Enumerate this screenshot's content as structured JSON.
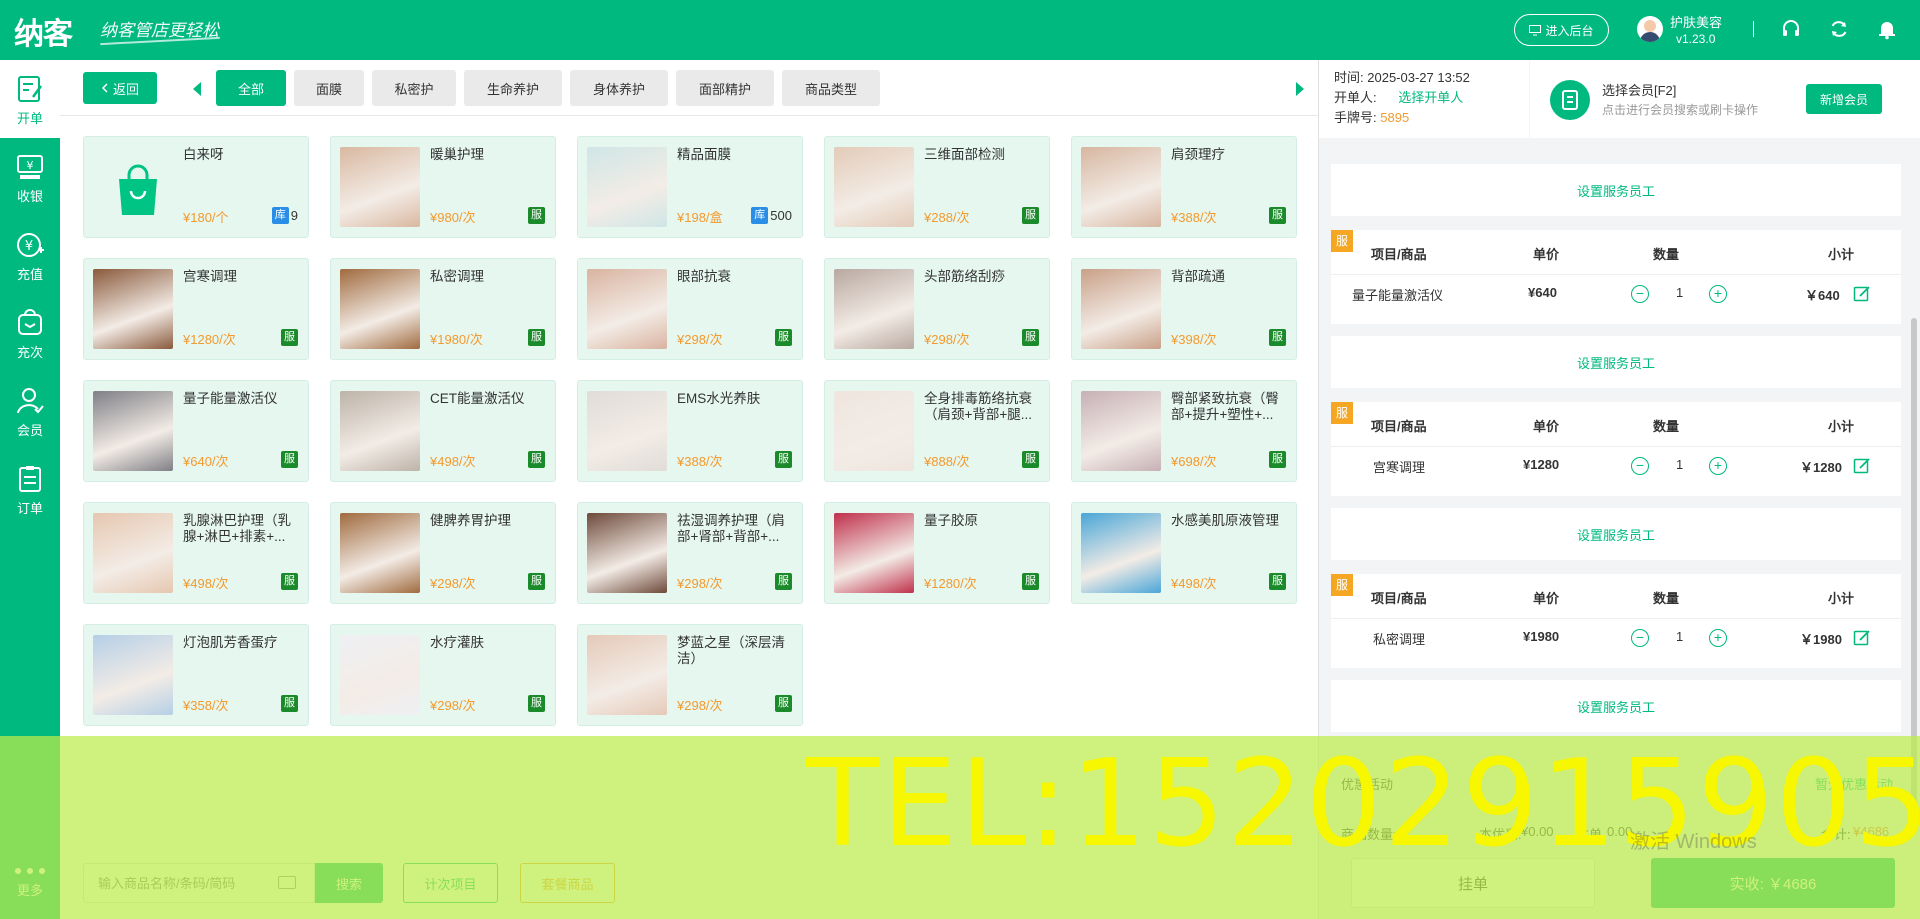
{
  "header": {
    "logo": "纳客",
    "slogan": "纳客管店更轻松",
    "backend_label": "进入后台",
    "store_name": "护肤美容",
    "version": "v1.23.0"
  },
  "sidebar": {
    "items": [
      {
        "label": "开单",
        "icon": "receipt-edit-icon"
      },
      {
        "label": "收银",
        "icon": "cashier-icon"
      },
      {
        "label": "充值",
        "icon": "yen-plus-icon"
      },
      {
        "label": "充次",
        "icon": "bag-recharge-icon"
      },
      {
        "label": "会员",
        "icon": "member-icon"
      },
      {
        "label": "订单",
        "icon": "order-list-icon"
      }
    ],
    "more_label": "更多"
  },
  "toolbar": {
    "back_label": "返回",
    "tabs": [
      "全部",
      "面膜",
      "私密护",
      "生命养护",
      "身体养护",
      "面部精护",
      "商品类型"
    ]
  },
  "products": [
    {
      "name": "白来呀",
      "price": "¥180/个",
      "stock_tag": "库",
      "stock": "9",
      "thumb": "bag-icon"
    },
    {
      "name": "暖巢护理",
      "price": "¥980/次",
      "tag": "服",
      "thumb": "#d9b8a0"
    },
    {
      "name": "精品面膜",
      "price": "¥198/盒",
      "stock_tag": "库",
      "stock": "500",
      "thumb": "#cfe6e6"
    },
    {
      "name": "三维面部检测",
      "price": "¥288/次",
      "tag": "服",
      "thumb": "#e3cbb8"
    },
    {
      "name": "肩颈理疗",
      "price": "¥388/次",
      "tag": "服",
      "thumb": "#d7b6a0"
    },
    {
      "name": "宫寒调理",
      "price": "¥1280/次",
      "tag": "服",
      "thumb": "#8a5a3c"
    },
    {
      "name": "私密调理",
      "price": "¥1980/次",
      "tag": "服",
      "thumb": "#a06b3f"
    },
    {
      "name": "眼部抗衰",
      "price": "¥298/次",
      "tag": "服",
      "thumb": "#d9b3a0"
    },
    {
      "name": "头部筋络刮痧",
      "price": "¥298/次",
      "tag": "服",
      "thumb": "#b8a8a0"
    },
    {
      "name": "背部疏通",
      "price": "¥398/次",
      "tag": "服",
      "thumb": "#c9a088"
    },
    {
      "name": "量子能量激活仪",
      "price": "¥640/次",
      "tag": "服",
      "thumb": "#7f7f86"
    },
    {
      "name": "CET能量激活仪",
      "price": "¥498/次",
      "tag": "服",
      "thumb": "#bcb3a8"
    },
    {
      "name": "EMS水光养肤",
      "price": "¥388/次",
      "tag": "服",
      "thumb": "#e0dcd8"
    },
    {
      "name": "全身排毒筋络抗衰（肩颈+背部+腿...",
      "price": "¥888/次",
      "tag": "服",
      "thumb": "#efe5df"
    },
    {
      "name": "臀部紧致抗衰（臀部+提升+塑性+...",
      "price": "¥698/次",
      "tag": "服",
      "thumb": "#c7b0b6"
    },
    {
      "name": "乳腺淋巴护理（乳腺+淋巴+排素+...",
      "price": "¥498/次",
      "tag": "服",
      "thumb": "#e6c7b0"
    },
    {
      "name": "健脾养胃护理",
      "price": "¥298/次",
      "tag": "服",
      "thumb": "#a06b3f"
    },
    {
      "name": "祛湿调养护理（肩部+肾部+背部+...",
      "price": "¥298/次",
      "tag": "服",
      "thumb": "#6e4a3a"
    },
    {
      "name": "量子胶原",
      "price": "¥1280/次",
      "tag": "服",
      "thumb": "#c0304c"
    },
    {
      "name": "水感美肌原液管理",
      "price": "¥498/次",
      "tag": "服",
      "thumb": "#4aa6d8"
    },
    {
      "name": "灯泡肌芳香蛋疗",
      "price": "¥358/次",
      "tag": "服",
      "thumb": "#b5cfe6"
    },
    {
      "name": "水疗灌肤",
      "price": "¥298/次",
      "tag": "服",
      "thumb": "#eef0f4"
    },
    {
      "name": "梦蓝之星（深层清洁）",
      "price": "¥298/次",
      "tag": "服",
      "thumb": "#e5c9b8"
    }
  ],
  "order_info": {
    "time_label": "时间:",
    "time_value": "2025-03-27 13:52",
    "opener_label": "开单人:",
    "opener_value": "选择开单人",
    "tag_label": "手牌号:",
    "tag_value": "5895"
  },
  "member": {
    "title": "选择会员[F2]",
    "subtitle": "点击进行会员搜索或刷卡操作",
    "new_member_label": "新增会员"
  },
  "order": {
    "set_staff_label": "设置服务员工",
    "svc_badge": "服",
    "headers": {
      "item": "项目/商品",
      "unit_price": "单价",
      "qty": "数量",
      "subtotal": "小计"
    },
    "lines": [
      {
        "name": "量子能量激活仪",
        "unit_price": "¥640",
        "qty": "1",
        "subtotal": "￥640"
      },
      {
        "name": "宫寒调理",
        "unit_price": "¥1280",
        "qty": "1",
        "subtotal": "￥1280"
      },
      {
        "name": "私密调理",
        "unit_price": "¥1980",
        "qty": "1",
        "subtotal": "￥1980"
      }
    ]
  },
  "summary": {
    "discount_label": "优惠活动",
    "discount_value": "暂无优惠活动",
    "goods_count_label": "商品数量:",
    "member_discount_label": "本优惠:",
    "member_discount_value": "¥0.00",
    "order_discount_label": "本单",
    "order_discount_value": "0.00",
    "total_label": "合计:",
    "total_value": "¥4686",
    "hold_label": "挂单",
    "pay_label": "实收: ￥4686"
  },
  "bottom": {
    "search_placeholder": "输入商品名称/条码/简码",
    "search_label": "搜索",
    "count_item_label": "计次项目",
    "package_label": "套餐商品"
  },
  "watermark": {
    "tel": "TEL:15202915905",
    "windows": "激活 Windows"
  },
  "colors": {
    "brand": "#00b97f",
    "price": "#f29a2e",
    "service_tag": "#1b8a2a",
    "stock_tag": "#2a8de6",
    "overlay": "#bcec4b",
    "watermark_text": "#f6f700"
  }
}
